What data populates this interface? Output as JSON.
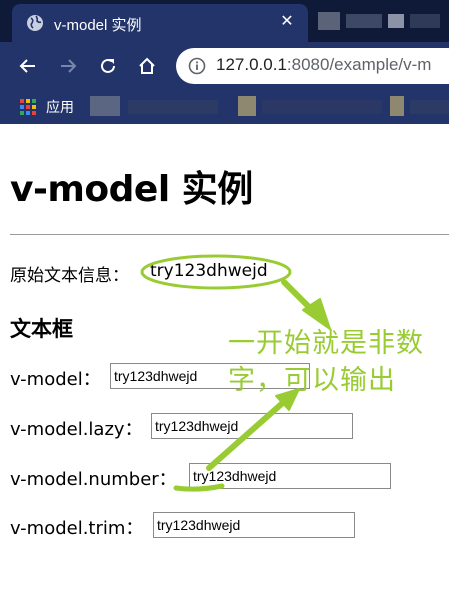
{
  "browser": {
    "tab": {
      "title": "v-model 实例",
      "close_glyph": "✕",
      "favicon_icon": "globe-icon"
    },
    "toolbar": {
      "back_icon": "arrow-left-icon",
      "forward_icon": "arrow-right-icon",
      "reload_icon": "reload-icon",
      "home_icon": "home-icon",
      "site_info_icon": "info-icon",
      "url_host": "127.0.0.1",
      "url_rest": ":8080/example/v-m"
    },
    "bookmarks": {
      "apps_label": "应用",
      "apps_icon": "apps-grid-icon"
    }
  },
  "page": {
    "title": "v-model 实例",
    "original_label": "原始文本信息：",
    "original_value": "try123dhwejd",
    "section_heading": "文本框",
    "rows": [
      {
        "label": "v-model：",
        "value": "try123dhwejd"
      },
      {
        "label": "v-model.lazy：",
        "value": "try123dhwejd"
      },
      {
        "label": "v-model.number：",
        "value": "try123dhwejd"
      },
      {
        "label": "v-model.trim：",
        "value": "try123dhwejd"
      }
    ]
  },
  "annotation": {
    "line1": "一开始就是非数",
    "line2": "字，可以输出",
    "color": "#99cc33"
  },
  "colors": {
    "tabstrip": "#0e1a38",
    "toolbar": "#22346a",
    "annotation": "#99cc33"
  }
}
